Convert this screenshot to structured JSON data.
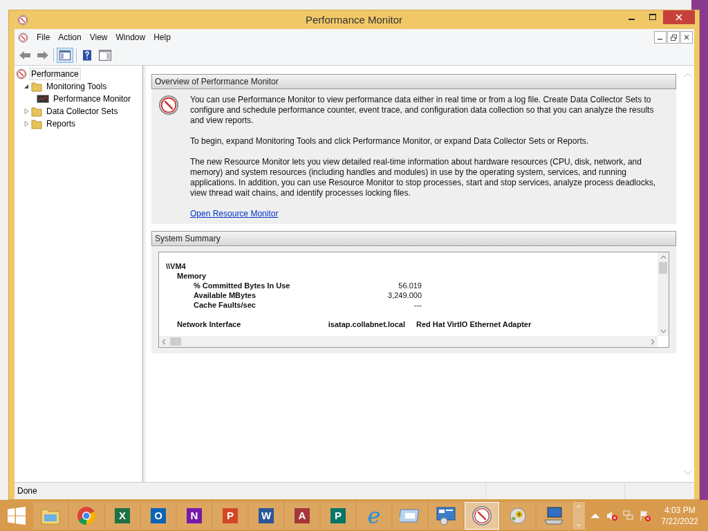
{
  "window": {
    "title": "Performance Monitor"
  },
  "menu": [
    "File",
    "Action",
    "View",
    "Window",
    "Help"
  ],
  "tree": [
    {
      "label": "Performance",
      "kind": "root",
      "selected": true,
      "children": [
        {
          "label": "Monitoring Tools",
          "kind": "folder",
          "expanded": true,
          "selected": false,
          "children": [
            {
              "label": "Performance Monitor",
              "kind": "monitor",
              "selected": false
            }
          ]
        },
        {
          "label": "Data Collector Sets",
          "kind": "folder",
          "expanded": false,
          "selected": false
        },
        {
          "label": "Reports",
          "kind": "folder",
          "expanded": false,
          "selected": false
        }
      ]
    }
  ],
  "overview": {
    "heading": "Overview of Performance Monitor",
    "paragraphs": [
      "You can use Performance Monitor to view performance data either in real time or from a log file. Create Data Collector Sets to configure and schedule performance counter, event trace, and configuration data collection so that you can analyze the results and view reports.",
      "To begin, expand Monitoring Tools and click Performance Monitor, or expand Data Collector Sets or Reports.",
      "The new Resource Monitor lets you view detailed real-time information about hardware resources (CPU, disk, network, and memory) and system resources (including handles and modules) in use by the operating system, services, and running applications. In addition, you can use Resource Monitor to stop processes, start and stop services, analyze process deadlocks, view thread wait chains, and identify processes locking files."
    ],
    "link": "Open Resource Monitor"
  },
  "summary": {
    "heading": "System Summary",
    "rows": [
      {
        "kind": "machine",
        "label": "\\\\VM4"
      },
      {
        "kind": "object",
        "label": "Memory"
      },
      {
        "kind": "counter",
        "label": "% Committed Bytes In Use",
        "value": "56.019"
      },
      {
        "kind": "counter",
        "label": "Available MBytes",
        "value": "3,249.000"
      },
      {
        "kind": "counter",
        "label": "Cache Faults/sec",
        "value": "---"
      },
      {
        "kind": "gap"
      },
      {
        "kind": "object",
        "label": "Network Interface",
        "value": "isatap.collabnet.local",
        "extra": "Red Hat VirtIO Ethernet Adapter"
      }
    ]
  },
  "status_bar": "Done",
  "taskbar": {
    "apps": [
      {
        "kind": "folder",
        "selected": false
      },
      {
        "kind": "chrome",
        "selected": false
      },
      {
        "kind": "letter",
        "label": "X",
        "color": "#1e7145",
        "selected": false
      },
      {
        "kind": "letter",
        "label": "O",
        "color": "#0a64b4",
        "selected": false
      },
      {
        "kind": "letter",
        "label": "N",
        "color": "#7719aa",
        "selected": false
      },
      {
        "kind": "letter",
        "label": "P",
        "color": "#d24726",
        "selected": false
      },
      {
        "kind": "letter",
        "label": "W",
        "color": "#2b579a",
        "selected": false
      },
      {
        "kind": "letter",
        "label": "A",
        "color": "#a4373a",
        "selected": false
      },
      {
        "kind": "letter",
        "label": "P",
        "color": "#077568",
        "selected": false
      },
      {
        "kind": "browser",
        "label": "e",
        "selected": false
      },
      {
        "kind": "window",
        "selected": false
      },
      {
        "kind": "panel",
        "selected": false
      },
      {
        "kind": "gauge",
        "selected": true
      },
      {
        "kind": "disc",
        "selected": false
      },
      {
        "kind": "computer",
        "selected": false
      }
    ],
    "time": "4:03 PM",
    "date": "7/22/2022"
  }
}
